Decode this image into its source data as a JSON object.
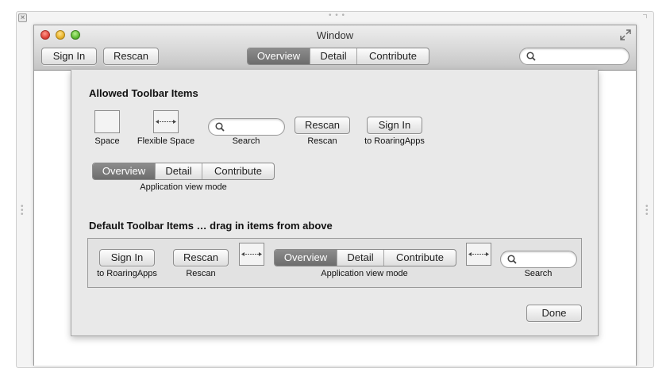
{
  "window": {
    "title": "Window"
  },
  "toolbar": {
    "sign_in": "Sign In",
    "rescan": "Rescan",
    "view_modes": [
      "Overview",
      "Detail",
      "Contribute"
    ],
    "selected_view": "Overview",
    "search_value": ""
  },
  "sheet": {
    "allowed_heading": "Allowed Toolbar Items",
    "default_heading": "Default Toolbar Items … drag in items from above",
    "allowed_items": {
      "space_label": "Space",
      "flexible_space_label": "Flexible Space",
      "search_label": "Search",
      "rescan_button": "Rescan",
      "rescan_label": "Rescan",
      "signin_button": "Sign In",
      "signin_label": "to RoaringApps",
      "view_modes": [
        "Overview",
        "Detail",
        "Contribute"
      ],
      "view_mode_label": "Application view mode"
    },
    "default_items": {
      "signin_button": "Sign In",
      "signin_label": "to RoaringApps",
      "rescan_button": "Rescan",
      "rescan_label": "Rescan",
      "view_modes": [
        "Overview",
        "Detail",
        "Contribute"
      ],
      "view_mode_label": "Application view mode",
      "search_label": "Search"
    },
    "done_button": "Done"
  }
}
